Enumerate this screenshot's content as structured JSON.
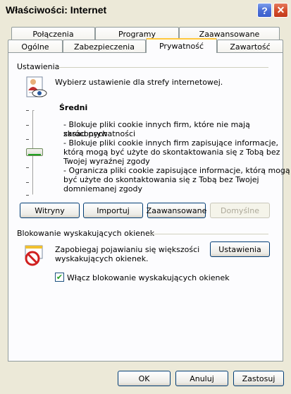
{
  "window": {
    "title": "Właściwości: Internet"
  },
  "tabs": {
    "row1": [
      "Połączenia",
      "Programy",
      "Zaawansowane"
    ],
    "row2": [
      "Ogólne",
      "Zabezpieczenia",
      "Prywatność",
      "Zawartość"
    ],
    "active": "Prywatność"
  },
  "settings": {
    "group_label": "Ustawienia",
    "instruction": "Wybierz ustawienie dla strefy internetowej.",
    "level_title": "Średni",
    "descriptions": [
      "- Blokuje pliki cookie innych firm, które nie mają skróconych",
      "zasad prywatności",
      "- Blokuje pliki cookie innych firm zapisujące informacje,",
      "którą mogą być użyte do skontaktowania się z Tobą bez",
      "Twojej wyraźnej zgody",
      "- Ogranicza pliki cookie zapisujące informacje, którą mogą",
      "być użyte do skontaktowania się z Tobą bez Twojej",
      "domniemanej zgody"
    ],
    "slider_level": "3 of 6",
    "buttons": {
      "sites": "Witryny",
      "import": "Importuj",
      "advanced": "Zaawansowane",
      "default": "Domyślne"
    }
  },
  "popup": {
    "group_label": "Blokowanie wyskakujących okienek",
    "description_line1": "Zapobiegaj pojawianiu się większości",
    "description_line2": "wyskakujących okienek.",
    "settings_button": "Ustawienia",
    "checkbox_label": "Włącz blokowanie wyskakujących okienek",
    "checkbox_checked": true
  },
  "footer": {
    "ok": "OK",
    "cancel": "Anuluj",
    "apply": "Zastosuj"
  },
  "icons": {
    "privacy": "person-eye-icon",
    "popup": "no-popup-icon"
  }
}
